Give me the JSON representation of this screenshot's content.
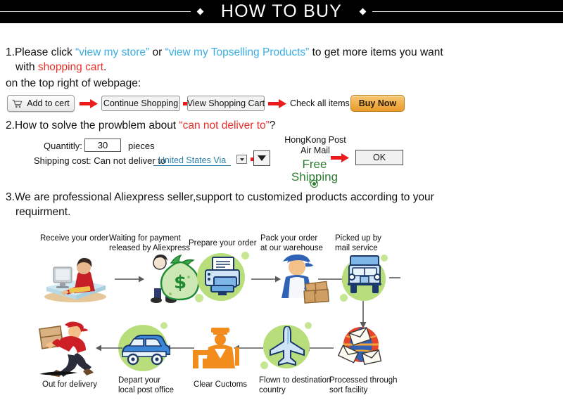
{
  "header": {
    "title": "HOW TO BUY",
    "bg": "#000000",
    "fg": "#ffffff"
  },
  "colors": {
    "link_blue": "#3aaee0",
    "alert_red": "#e8302a",
    "free_green": "#2e7d32",
    "buy_orange": "#e99a2b"
  },
  "section1": {
    "number": "1.",
    "lead": "Please click ",
    "link1": "“view my store”",
    "mid": " or ",
    "link2": "“view my Topselling Products”",
    "tail": " to get more items you want",
    "line2_pre": "with ",
    "line2_red": "shopping cart",
    "line2_post": ".",
    "subtitle": "on the top right of webpage:",
    "buttons": {
      "add_to_cart": "Add to cert",
      "cart_icon": "shopping-cart-icon",
      "continue_shopping": "Continue Shopping",
      "view_shopping_cart": "View Shopping Cart",
      "check_all_items": "Check all items",
      "buy_now": "Buy Now"
    }
  },
  "section2": {
    "number": "2.",
    "text_pre": "How to solve the prowblem about ",
    "text_red": "“can not deliver to”",
    "text_post": "?",
    "quantity_label": "Quantitly:",
    "quantity_value": "30",
    "pieces_label": "pieces",
    "shipping_label": "Shipping cost: Can not deliver to",
    "country_value": "United States Via",
    "carrier_line1": "HongKong Post",
    "carrier_line2": "Air Mail",
    "free_shipping_line1": "Free",
    "free_shipping_line2": "Shipping",
    "ok_label": "OK"
  },
  "section3": {
    "number": "3.",
    "line1": "We are professional Aliexpress seller,support to customized products according to your",
    "line2": "requirment."
  },
  "flow": {
    "top_row": [
      {
        "caption": "Receive your order",
        "icon": "person-at-computer-icon"
      },
      {
        "caption": "Waiting for payment\nreleased by Aliexpress",
        "icon": "money-bag-icon"
      },
      {
        "caption": "Prepare your order",
        "icon": "printer-icon"
      },
      {
        "caption": "Pack your order\nat our warehouse",
        "icon": "worker-packing-icon"
      },
      {
        "caption": "Picked up by\nmail service",
        "icon": "delivery-truck-icon"
      }
    ],
    "bottom_row": [
      {
        "caption": "Out for delivery",
        "icon": "running-courier-icon"
      },
      {
        "caption": "Depart your\nlocal post office",
        "icon": "delivery-van-icon"
      },
      {
        "caption": "Clear Cuctoms",
        "icon": "customs-officer-icon"
      },
      {
        "caption": "Flown to destination\ncountry",
        "icon": "airplane-icon"
      },
      {
        "caption": "Processed through\nsort facility",
        "icon": "mail-sorting-globe-icon"
      }
    ]
  }
}
